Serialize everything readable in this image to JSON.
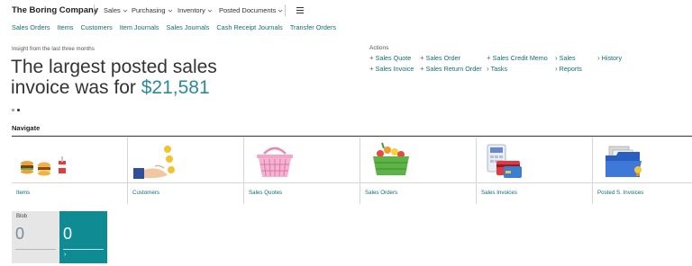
{
  "header": {
    "company": "The Boring Company",
    "menus": [
      "Sales",
      "Purchasing",
      "Inventory",
      "Posted Documents"
    ]
  },
  "subnav": [
    "Sales Orders",
    "Items",
    "Customers",
    "Item Journals",
    "Sales Journals",
    "Cash Receipt Journals",
    "Transfer Orders"
  ],
  "insight": {
    "label": "Insight from the last three months",
    "headline_prefix": "The largest posted sales invoice was for",
    "amount": "$21,581"
  },
  "actions": {
    "title": "Actions",
    "items": [
      {
        "label": "Sales Quote",
        "symbol": "+"
      },
      {
        "label": "Sales Order",
        "symbol": "+"
      },
      {
        "label": "Sales Credit Memo",
        "symbol": "+"
      },
      {
        "label": "Sales",
        "symbol": "›"
      },
      {
        "label": "History",
        "symbol": "›"
      },
      {
        "label": "Sales Invoice",
        "symbol": "+"
      },
      {
        "label": "Sales Return Order",
        "symbol": "+"
      },
      {
        "label": "Tasks",
        "symbol": "›"
      },
      {
        "label": "Reports",
        "symbol": "›"
      }
    ]
  },
  "navigate": {
    "title": "Navigate",
    "tiles": [
      {
        "label": "Items"
      },
      {
        "label": "Customers"
      },
      {
        "label": "Sales Quotes"
      },
      {
        "label": "Sales Orders"
      },
      {
        "label": "Sales Invoices"
      },
      {
        "label": "Posted S. Invoices"
      }
    ]
  },
  "cues": [
    {
      "title": "Blob",
      "value": "0"
    },
    {
      "title": "",
      "value": "0",
      "arrow": "›"
    }
  ],
  "colors": {
    "accent": "#0f6f78",
    "amount": "#2a8b96",
    "cue_teal": "#0f8b94"
  }
}
